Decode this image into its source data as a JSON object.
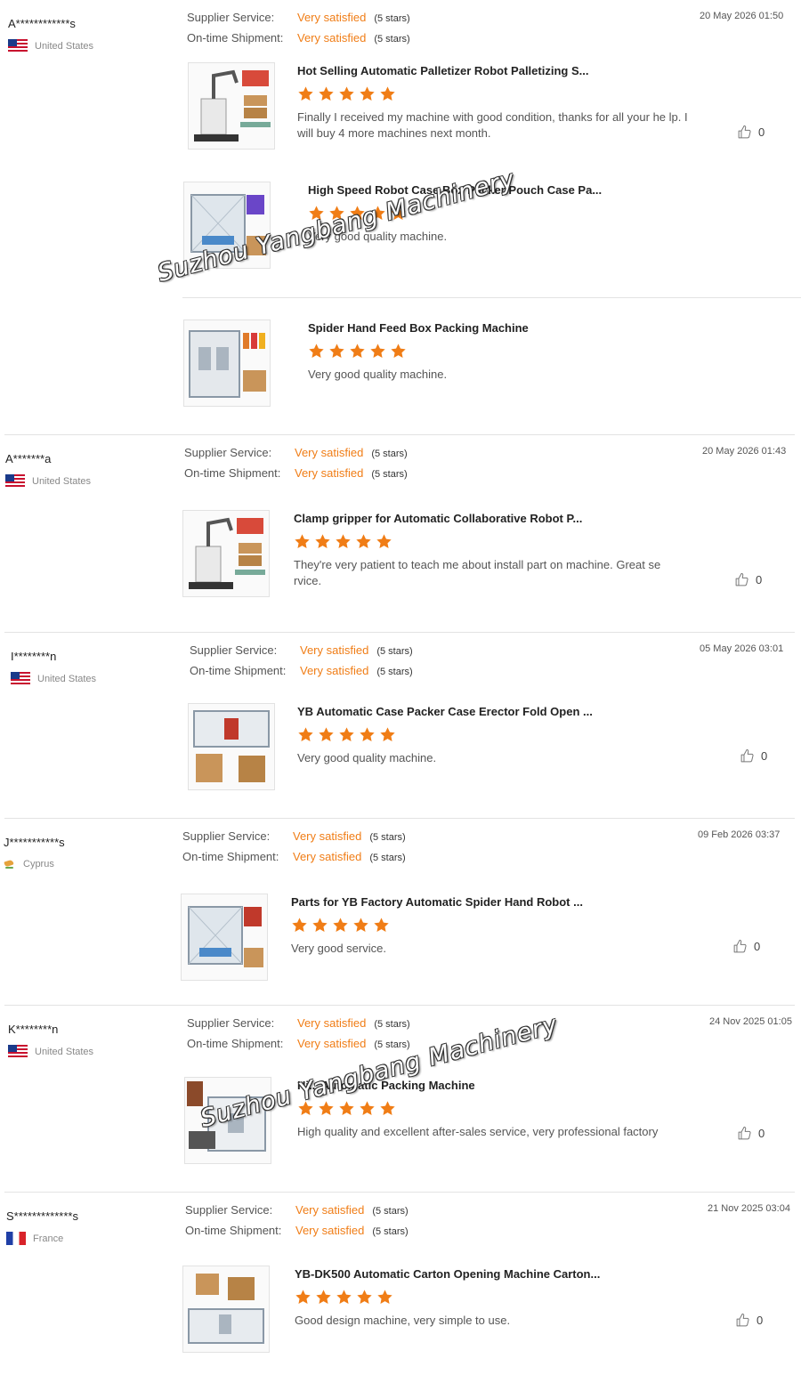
{
  "colors": {
    "accent": "#f07d16",
    "separator": "#e3e3e3"
  },
  "watermark_text": "Suzhou Yangbang Machinery",
  "reviews": [
    {
      "user": "A************s",
      "country": "United States",
      "flag": "us",
      "supplier_label": "Supplier Service:",
      "supplier_value": "Very satisfied",
      "supplier_stars": "(5 stars)",
      "shipment_label": "On-time Shipment:",
      "shipment_value": "Very satisfied",
      "shipment_stars": "(5 stars)",
      "date": "20 May 2026 01:50",
      "like_count": "0",
      "products": [
        {
          "title": "Hot Selling Automatic Palletizer Robot Palletizing S...",
          "rating": 5,
          "comment": "Finally I received my machine with good condition, thanks for all your he lp. I will buy 4 more machines next month.",
          "image_icon": "palletizer-robot-image"
        },
        {
          "title": "High Speed Robot Case Box Packer Pouch Case Pa...",
          "rating": 5,
          "comment": "Very good quality machine.",
          "image_icon": "case-packer-image"
        },
        {
          "title": "Spider Hand Feed Box Packing Machine",
          "rating": 5,
          "comment": "Very good quality machine.",
          "image_icon": "box-packing-machine-image"
        }
      ]
    },
    {
      "user": "A*******a",
      "country": "United States",
      "flag": "us",
      "supplier_label": "Supplier Service:",
      "supplier_value": "Very satisfied",
      "supplier_stars": "(5 stars)",
      "shipment_label": "On-time Shipment:",
      "shipment_value": "Very satisfied",
      "shipment_stars": "(5 stars)",
      "date": "20 May 2026 01:43",
      "like_count": "0",
      "products": [
        {
          "title": "Clamp gripper for Automatic Collaborative Robot P...",
          "rating": 5,
          "comment": "They're very patient to teach me about install part on machine. Great se rvice.",
          "image_icon": "palletizer-robot-image"
        }
      ]
    },
    {
      "user": "I********n",
      "country": "United States",
      "flag": "us",
      "supplier_label": "Supplier Service:",
      "supplier_value": "Very satisfied",
      "supplier_stars": "(5 stars)",
      "shipment_label": "On-time Shipment:",
      "shipment_value": "Very satisfied",
      "shipment_stars": "(5 stars)",
      "date": "05 May 2026 03:01",
      "like_count": "0",
      "products": [
        {
          "title": "YB Automatic Case Packer Case Erector Fold Open ...",
          "rating": 5,
          "comment": "Very good quality machine.",
          "image_icon": "case-erector-image"
        }
      ]
    },
    {
      "user": "J***********s",
      "country": "Cyprus",
      "flag": "cy",
      "supplier_label": "Supplier Service:",
      "supplier_value": "Very satisfied",
      "supplier_stars": "(5 stars)",
      "shipment_label": "On-time Shipment:",
      "shipment_value": "Very satisfied",
      "shipment_stars": "(5 stars)",
      "date": "09 Feb 2026 03:37",
      "like_count": "0",
      "products": [
        {
          "title": "Parts for YB Factory Automatic Spider Hand Robot ...",
          "rating": 5,
          "comment": "Very good service.",
          "image_icon": "spider-hand-robot-image"
        }
      ]
    },
    {
      "user": "K********n",
      "country": "United States",
      "flag": "us",
      "supplier_label": "Supplier Service:",
      "supplier_value": "Very satisfied",
      "supplier_stars": "(5 stars)",
      "shipment_label": "On-time Shipment:",
      "shipment_value": "Very satisfied",
      "shipment_stars": "(5 stars)",
      "date": "24 Nov 2025 01:05",
      "like_count": "0",
      "products": [
        {
          "title": "Hi... Automatic Packing Machine",
          "rating": 5,
          "comment": "High quality and excellent after-sales service, very professional factory",
          "image_icon": "packing-machine-image"
        }
      ]
    },
    {
      "user": "S*************s",
      "country": "France",
      "flag": "fr",
      "supplier_label": "Supplier Service:",
      "supplier_value": "Very satisfied",
      "supplier_stars": "(5 stars)",
      "shipment_label": "On-time Shipment:",
      "shipment_value": "Very satisfied",
      "shipment_stars": "(5 stars)",
      "date": "21 Nov 2025 03:04",
      "like_count": "0",
      "products": [
        {
          "title": "YB-DK500 Automatic Carton Opening Machine Carton...",
          "rating": 5,
          "comment": "Good design machine, very simple to use.",
          "image_icon": "carton-opening-machine-image"
        }
      ]
    }
  ]
}
